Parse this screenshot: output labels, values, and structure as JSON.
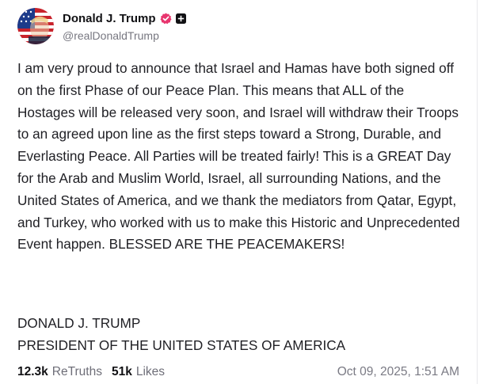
{
  "author": {
    "display_name": "Donald J. Trump",
    "handle": "@realDonaldTrump"
  },
  "post": {
    "body": "I am very proud to announce that Israel and Hamas have both signed off on the first Phase of our Peace Plan. This means that ALL of the Hostages will be released very soon, and Israel will withdraw their Troops to an agreed upon line as the first steps toward a Strong, Durable, and Everlasting Peace. All Parties will be treated fairly! This is a GREAT Day for the Arab and Muslim World, Israel, all surrounding Nations, and the United States of America, and we thank the mediators from Qatar, Egypt, and Turkey, who worked with us to make this Historic and Unprecedented Event happen. BLESSED ARE THE PEACEMAKERS!",
    "signature_name": "DONALD J. TRUMP",
    "signature_title": "PRESIDENT OF THE UNITED STATES OF AMERICA"
  },
  "stats": {
    "retruths_count": "12.3k",
    "retruths_label": "ReTruths",
    "likes_count": "51k",
    "likes_label": "Likes"
  },
  "timestamp": "Oct 09, 2025, 1:51 AM",
  "colors": {
    "verified_badge": "#e8356e",
    "text": "#1f1f24",
    "muted": "#777780"
  },
  "icons": {
    "verified": "verified-badge-icon",
    "plus": "plus-badge-icon"
  }
}
